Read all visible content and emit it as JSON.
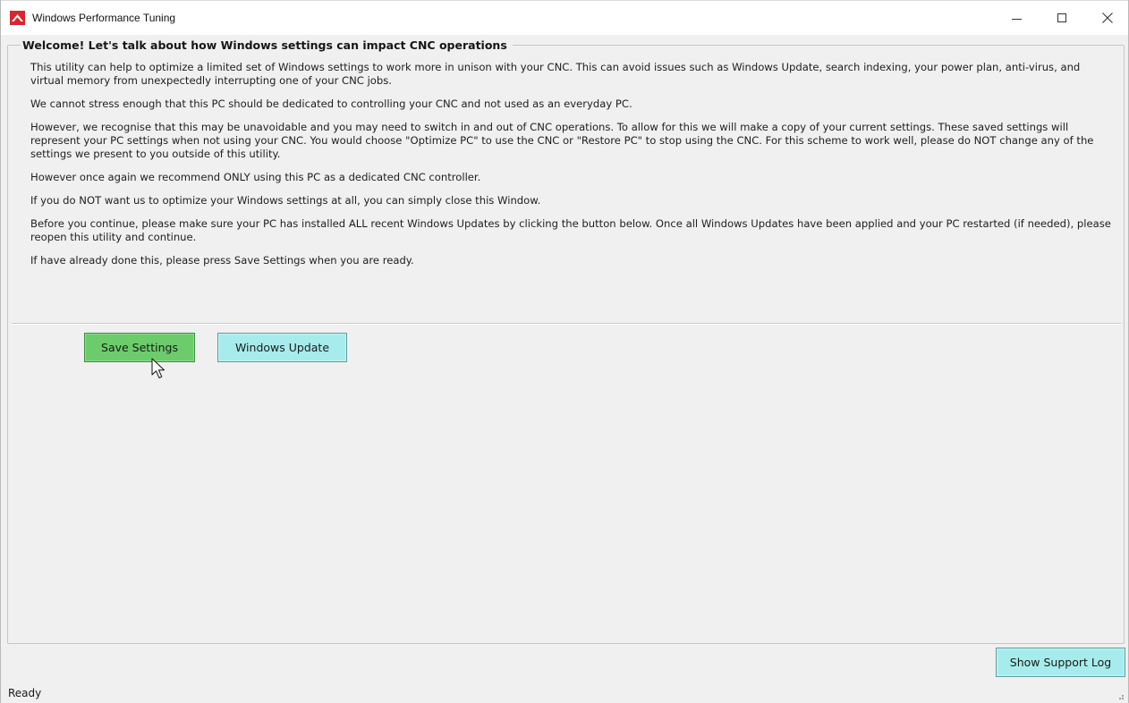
{
  "window": {
    "title": "Windows Performance Tuning",
    "brand_color": "#d9262c",
    "controls": {
      "minimize_icon": "minimize-icon",
      "maximize_icon": "maximize-icon",
      "close_icon": "close-icon"
    }
  },
  "group": {
    "title": "Welcome! Let's talk about how Windows settings can impact CNC operations"
  },
  "paragraphs": [
    "This utility can help to optimize a limited set of Windows settings to work more in unison with your CNC. This can avoid issues such as Windows Update, search indexing, your power plan, anti-virus, and virtual memory from unexpectedly interrupting one of your CNC jobs.",
    "We cannot stress enough that this PC should be dedicated to controlling your CNC and not used as an everyday PC.",
    "However, we recognise that this may be unavoidable and you may need to switch in and out of CNC operations. To allow for this we will make a copy of your current settings. These saved settings will represent your PC settings when not using your CNC. You would choose \"Optimize PC\" to use the CNC or \"Restore PC\" to stop using the CNC. For this scheme to work well, please do NOT change any of the settings we present to you outside of this utility.",
    "However once again we recommend ONLY using this PC as a dedicated CNC controller.",
    "If you do NOT want us to optimize your Windows settings at all, you can simply close this Window.",
    "Before you continue, please make sure your PC has installed ALL recent Windows Updates by clicking the button below. Once all Windows Updates have been applied and your PC restarted (if needed), please reopen this utility and continue.",
    "If have already done this, please press Save Settings when you are ready."
  ],
  "buttons": {
    "save_settings": "Save Settings",
    "windows_update": "Windows Update",
    "show_support_log": "Show Support Log"
  },
  "colors": {
    "save_button": "#6ccc6c",
    "update_button": "#a7ecec",
    "support_log_button": "#a7ecec"
  },
  "status": {
    "text": "Ready"
  }
}
